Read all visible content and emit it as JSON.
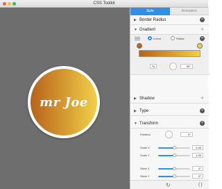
{
  "window": {
    "title": "CSS Toolkit"
  },
  "preview": {
    "text": "mr Joe",
    "gradient_start": "#b8621b",
    "gradient_end": "#f1d047"
  },
  "tabs": [
    {
      "label": "Style"
    },
    {
      "label": "Animation"
    }
  ],
  "sections": {
    "border_radius": {
      "label": "Border Radius"
    },
    "gradient": {
      "label": "Gradient",
      "mode_options": [
        {
          "label": "Linear",
          "selected": true
        },
        {
          "label": "Radial",
          "selected": false
        }
      ],
      "angle_label": "Tu",
      "angle_value": "90°",
      "stop_colors": [
        "#b8621b",
        "#f1d047"
      ]
    },
    "shadow": {
      "label": "Shadow"
    },
    "type": {
      "label": "Type"
    },
    "transform": {
      "label": "Transform",
      "rotation": {
        "label": "Rotation",
        "value": "0°"
      },
      "scale_x": {
        "label": "Scale X",
        "value": "1.00",
        "slider_fraction": 0.5
      },
      "scale_y": {
        "label": "Scale Y",
        "value": "1.00",
        "slider_fraction": 0.5
      },
      "skew_x": {
        "label": "Skew X",
        "value": "0°",
        "slider_fraction": 0.5
      },
      "skew_y": {
        "label": "Skew Y",
        "value": "0°",
        "slider_fraction": 0.5
      }
    }
  },
  "footer": {
    "reset_icon": "refresh-icon",
    "code_label": "{ }"
  },
  "colors": {
    "accent": "#2f8fe8",
    "canvas": "#6e6e6e"
  }
}
